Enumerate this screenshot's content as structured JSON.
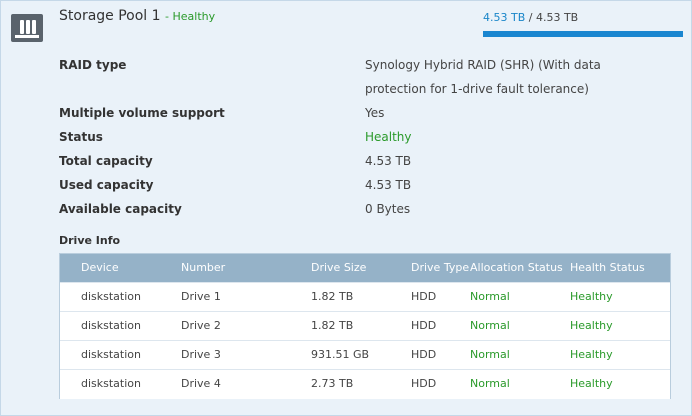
{
  "pool": {
    "title": "Storage Pool 1",
    "separator": " - ",
    "status": "Healthy",
    "used": "4.53 TB",
    "slash": " / ",
    "total": "4.53 TB",
    "usage_fraction": 1.0
  },
  "properties": [
    {
      "label": "RAID type",
      "value": "Synology Hybrid RAID (SHR) (With data protection for 1-drive fault tolerance)"
    },
    {
      "label": "Multiple volume support",
      "value": "Yes"
    },
    {
      "label": "Status",
      "value": "Healthy"
    },
    {
      "label": "Total capacity",
      "value": "4.53 TB"
    },
    {
      "label": "Used capacity",
      "value": "4.53 TB"
    },
    {
      "label": "Available capacity",
      "value": "0 Bytes"
    }
  ],
  "drive_info": {
    "heading": "Drive Info",
    "columns": [
      "Device",
      "Number",
      "Drive Size",
      "Drive Type",
      "Allocation Status",
      "Health Status"
    ],
    "rows": [
      {
        "device": "diskstation",
        "number": "Drive 1",
        "size": "1.82 TB",
        "type": "HDD",
        "allocation": "Normal",
        "health": "Healthy"
      },
      {
        "device": "diskstation",
        "number": "Drive 2",
        "size": "1.82 TB",
        "type": "HDD",
        "allocation": "Normal",
        "health": "Healthy"
      },
      {
        "device": "diskstation",
        "number": "Drive 3",
        "size": "931.51 GB",
        "type": "HDD",
        "allocation": "Normal",
        "health": "Healthy"
      },
      {
        "device": "diskstation",
        "number": "Drive 4",
        "size": "2.73 TB",
        "type": "HDD",
        "allocation": "Normal",
        "health": "Healthy"
      }
    ]
  },
  "colors": {
    "healthy": "#2a9a2a",
    "accent": "#1a86d0",
    "table_header": "#95b2c8"
  },
  "icons": {
    "pool": "storage-pool-icon"
  }
}
